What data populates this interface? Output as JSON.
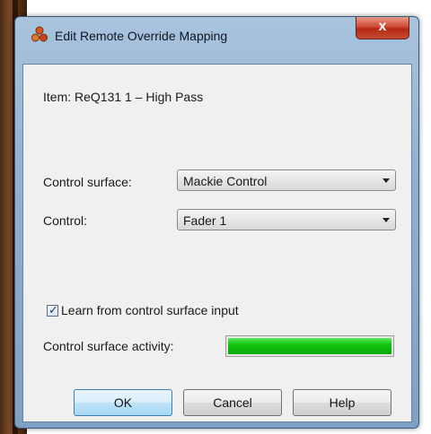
{
  "window": {
    "title": "Edit Remote Override Mapping",
    "close_label": "x"
  },
  "item": {
    "text": "Item: ReQ131 1 – High Pass"
  },
  "control_surface": {
    "label": "Control surface:",
    "value": "Mackie Control"
  },
  "control": {
    "label": "Control:",
    "value": "Fader 1"
  },
  "learn": {
    "label": "Learn from control surface input",
    "checked": true
  },
  "activity": {
    "label": "Control surface activity:",
    "level": 1.0,
    "color": "#12c40f"
  },
  "buttons": {
    "ok": "OK",
    "cancel": "Cancel",
    "help": "Help"
  },
  "icons": {
    "app": "reason-app-icon",
    "close": "close-icon",
    "dropdown": "chevron-down-icon",
    "check": "checkmark-icon"
  }
}
